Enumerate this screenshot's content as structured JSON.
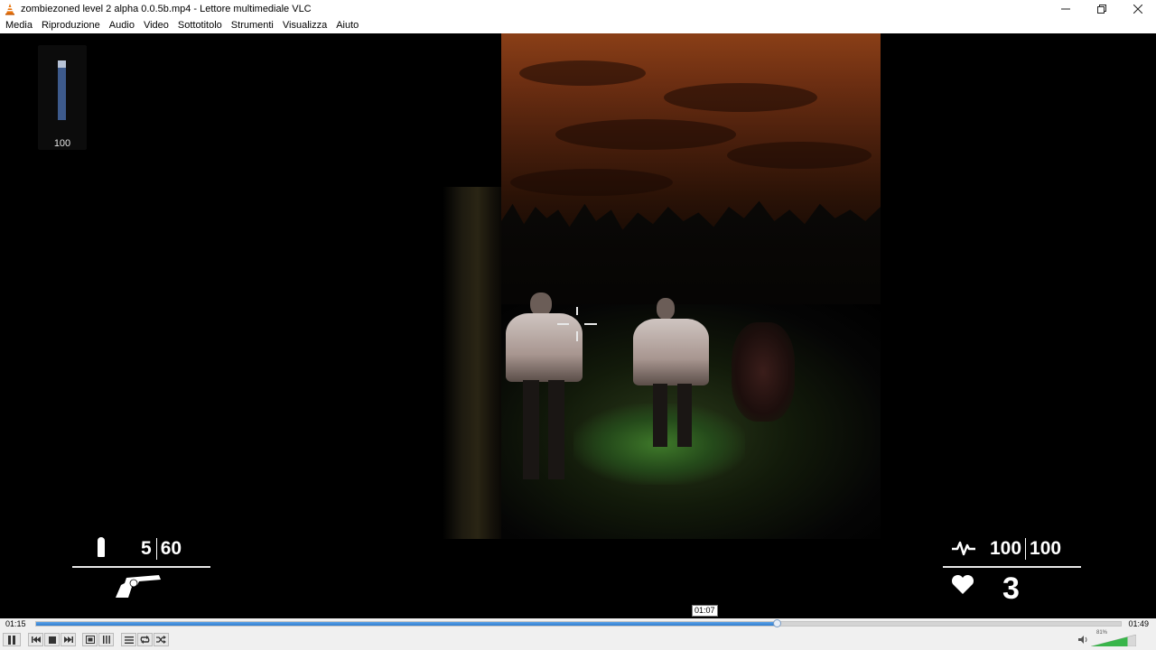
{
  "window": {
    "title": "zombiezoned level 2 alpha 0.0.5b.mp4 - Lettore multimediale VLC",
    "icon": "vlc-cone-icon",
    "controls": [
      "minimize-icon",
      "restore-icon",
      "close-icon"
    ]
  },
  "menu": {
    "items": [
      "Media",
      "Riproduzione",
      "Audio",
      "Video",
      "Sottotitolo",
      "Strumenti",
      "Visualizza",
      "Aiuto"
    ]
  },
  "osd": {
    "volume_value": "100",
    "volume_level": 1.0
  },
  "hud": {
    "ammo_clip": "5",
    "ammo_reserve": "60",
    "health_current": "100",
    "health_max": "100",
    "lives": "3",
    "weapon": "revolver-icon",
    "ammo_icon": "bullet-icon",
    "health_icon": "pulse-icon",
    "lives_icon": "heart-icon"
  },
  "player": {
    "time_elapsed": "01:15",
    "time_total": "01:49",
    "hover_time": "01:07",
    "progress": 0.684,
    "volume_percent": "81%",
    "volume_level": 0.81,
    "accent_color": "#2f7ed0",
    "buttons": [
      "pause-icon",
      "previous-icon",
      "stop-icon",
      "next-icon",
      "fullscreen-icon",
      "extended-settings-icon",
      "playlist-icon",
      "loop-icon",
      "shuffle-icon"
    ]
  }
}
